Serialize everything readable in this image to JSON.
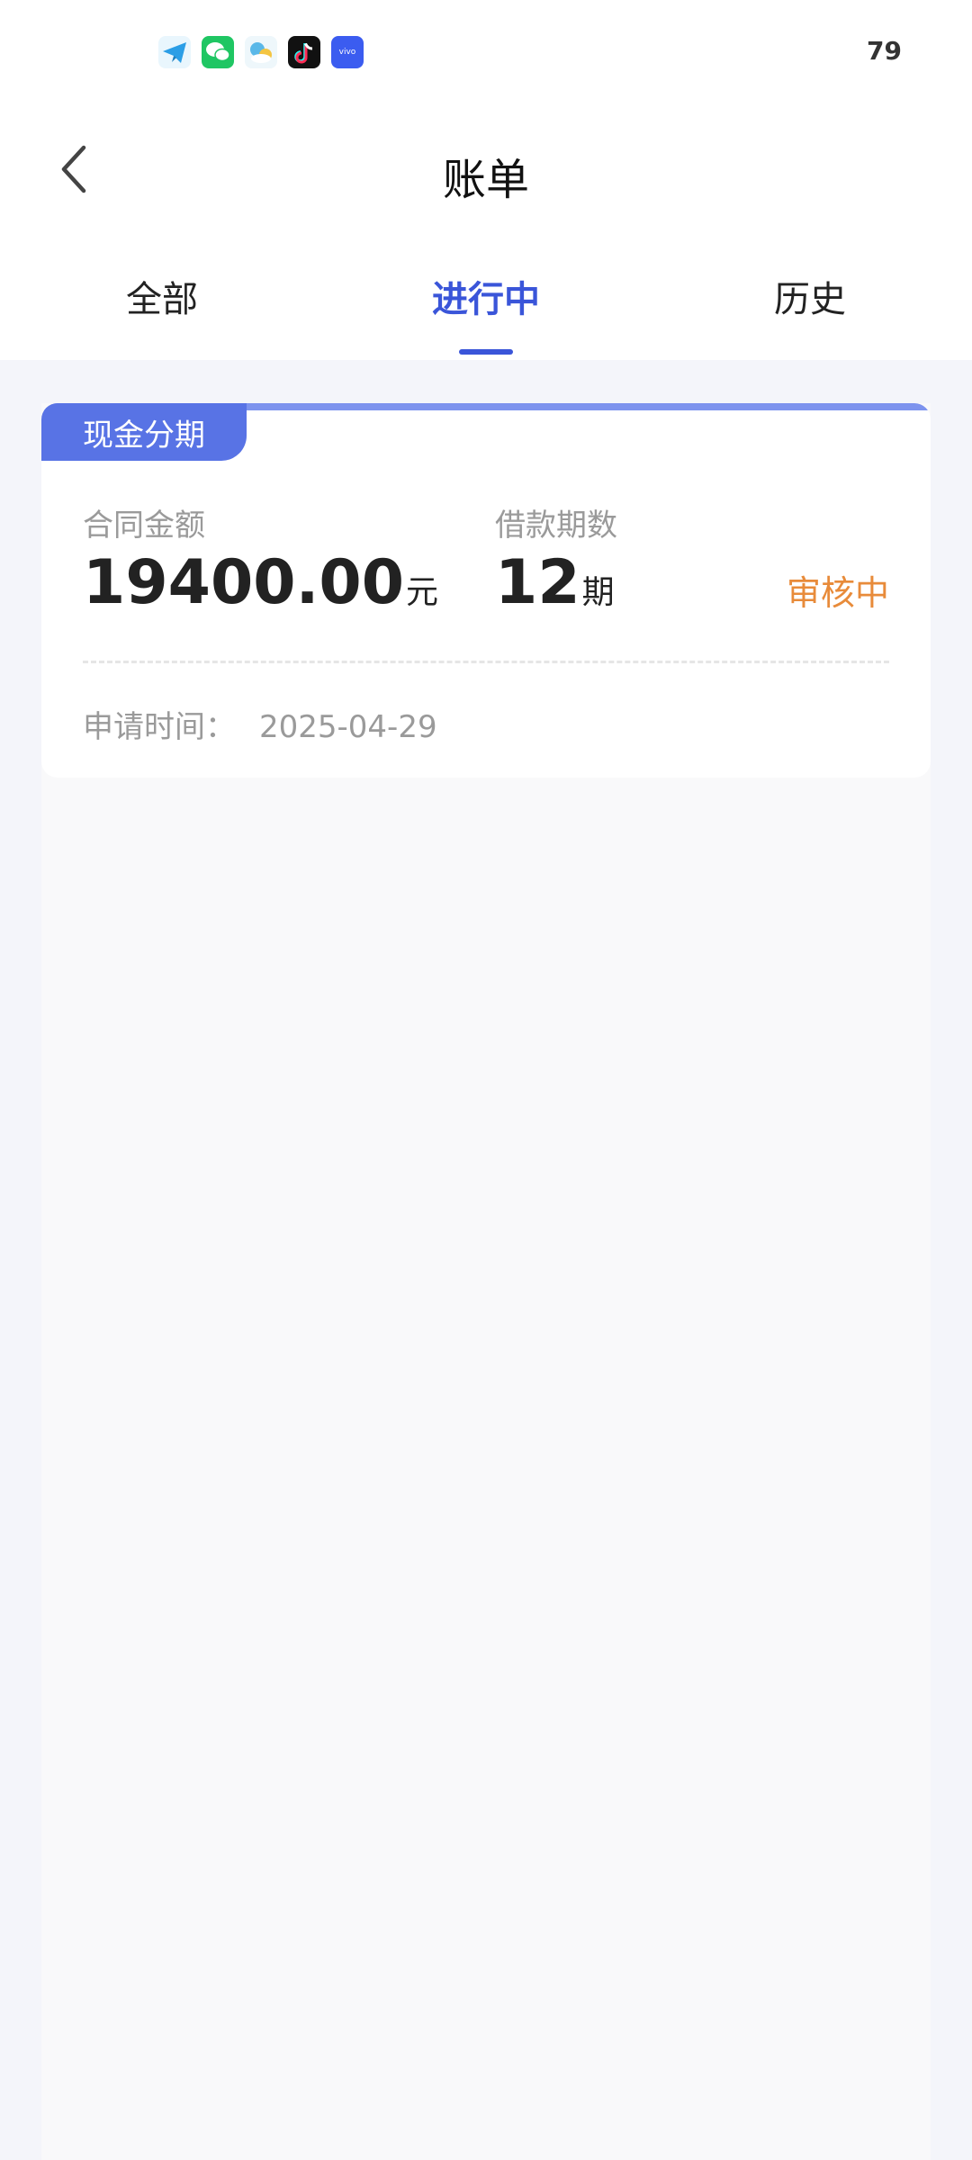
{
  "status_bar": {
    "battery": "79",
    "notification_icons": [
      "telegram-icon",
      "wechat-icon",
      "weather-icon",
      "douyin-icon",
      "vivo-icon"
    ],
    "vivo_label": "vivo"
  },
  "header": {
    "title": "账单"
  },
  "tabs": [
    {
      "label": "全部",
      "active": false
    },
    {
      "label": "进行中",
      "active": true
    },
    {
      "label": "历史",
      "active": false
    }
  ],
  "bill_card": {
    "tag": "现金分期",
    "amount_label": "合同金额",
    "amount_value": "19400.00",
    "amount_unit": "元",
    "period_label": "借款期数",
    "period_value": "12",
    "period_unit": "期",
    "status": "审核中",
    "apply_label": "申请时间：",
    "apply_date": "2025-04-29"
  },
  "colors": {
    "accent": "#3a55d9",
    "tag": "#5873e5",
    "status": "#e88b3a"
  }
}
